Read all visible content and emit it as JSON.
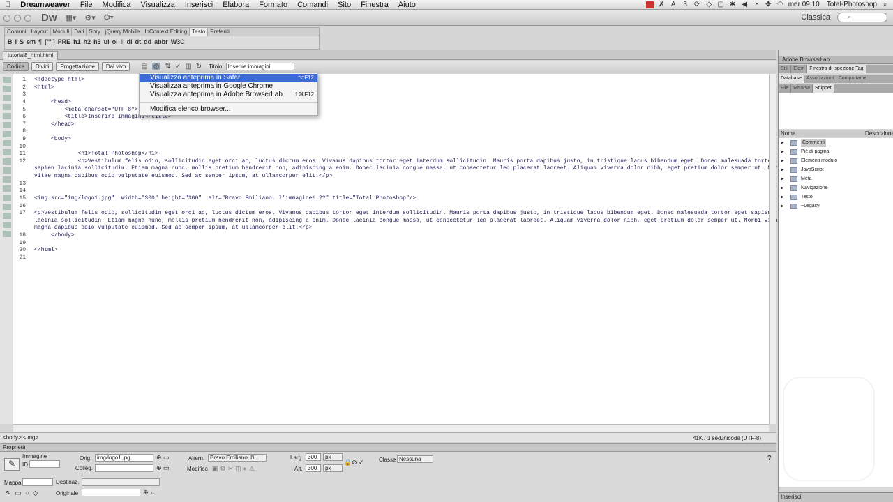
{
  "menubar": {
    "apple": "",
    "app_name": "Dreamweaver",
    "items": [
      "File",
      "Modifica",
      "Visualizza",
      "Inserisci",
      "Elabora",
      "Formato",
      "Comandi",
      "Sito",
      "Finestra",
      "Aiuto"
    ],
    "tray_badge": "3",
    "clock": "mer 09:10",
    "user": "Total-Photoshop"
  },
  "appbar": {
    "logo": "Dw",
    "workspace": "Classica"
  },
  "insert_bar": {
    "tabs": [
      "Comuni",
      "Layout",
      "Moduli",
      "Dati",
      "Spry",
      "jQuery Mobile",
      "InContext Editing",
      "Testo",
      "Preferiti"
    ],
    "active_tab": "Testo",
    "tools": [
      "B",
      "I",
      "S",
      "em",
      "¶",
      "[\"\"]",
      "PRE",
      "h1",
      "h2",
      "h3",
      "ul",
      "ol",
      "li",
      "dl",
      "dt",
      "dd",
      "abbr",
      "W3C"
    ]
  },
  "document": {
    "tab_name": "tutorial8_html.html",
    "views": [
      "Codice",
      "Dividi",
      "Progettazione",
      "Dal vivo"
    ],
    "active_view": "Codice",
    "title_label": "Titolo:",
    "title_value": "Inserire immagini"
  },
  "preview_menu": {
    "items": [
      {
        "label": "Visualizza anteprima in Safari",
        "shortcut": "⌥F12",
        "selected": true
      },
      {
        "label": "Visualizza anteprima in Google Chrome",
        "shortcut": ""
      },
      {
        "label": "Visualizza anteprima in Adobe BrowserLab",
        "shortcut": "⇧⌘F12"
      },
      {
        "label": "Modifica elenco browser...",
        "shortcut": ""
      }
    ]
  },
  "code_lines": [
    {
      "n": "1",
      "text": "<!doctype html>"
    },
    {
      "n": "2",
      "text": "<html>"
    },
    {
      "n": "3",
      "text": ""
    },
    {
      "n": "4",
      "text": "     <head>"
    },
    {
      "n": "5",
      "text": "         <meta charset=\"UTF-8\">"
    },
    {
      "n": "6",
      "text": "         <title>Inserire immagini</title>"
    },
    {
      "n": "7",
      "text": "     </head>"
    },
    {
      "n": "8",
      "text": ""
    },
    {
      "n": "9",
      "text": "     <body>"
    },
    {
      "n": "10",
      "text": ""
    },
    {
      "n": "11",
      "text": "             <h1>Total Photoshop</h1>"
    },
    {
      "n": "12",
      "text": "             <p>Vestibulum felis odio, sollicitudin eget orci ac, luctus dictum eros. Vivamus dapibus tortor eget interdum sollicitudin. Mauris porta dapibus justo, in tristique lacus bibendum eget. Donec malesuada tortor eget"
    },
    {
      "n": "",
      "text": "sapien lacinia sollicitudin. Etiam magna nunc, mollis pretium hendrerit non, adipiscing a enim. Donec lacinia congue massa, ut consectetur leo placerat laoreet. Aliquam viverra dolor nibh, eget pretium dolor semper ut. Morbi"
    },
    {
      "n": "",
      "text": "vitae magna dapibus odio vulputate euismod. Sed ac semper ipsum, at ullamcorper elit.</p>"
    },
    {
      "n": "13",
      "text": ""
    },
    {
      "n": "14",
      "text": ""
    },
    {
      "n": "15",
      "text": "<img src=\"img/logo1.jpg\"  width=\"300\" height=\"300\"  alt=\"Bravo Emiliano, l'immagine!!??\" title=\"Total Photoshop\"/>"
    },
    {
      "n": "16",
      "text": ""
    },
    {
      "n": "17",
      "text": "<p>Vestibulum felis odio, sollicitudin eget orci ac, luctus dictum eros. Vivamus dapibus tortor eget interdum sollicitudin. Mauris porta dapibus justo, in tristique lacus bibendum eget. Donec malesuada tortor eget sapien"
    },
    {
      "n": "",
      "text": "lacinia sollicitudin. Etiam magna nunc, mollis pretium hendrerit non, adipiscing a enim. Donec lacinia congue massa, ut consectetur leo placerat laoreet. Aliquam viverra dolor nibh, eget pretium dolor semper ut. Morbi vitae"
    },
    {
      "n": "",
      "text": "magna dapibus odio vulputate euismod. Sed ac semper ipsum, at ullamcorper elit.</p>"
    },
    {
      "n": "18",
      "text": "     </body>"
    },
    {
      "n": "19",
      "text": ""
    },
    {
      "n": "20",
      "text": "</html>"
    },
    {
      "n": "21",
      "text": ""
    }
  ],
  "status": {
    "tag_selector": "<body> <img>",
    "size": "41K / 1 sec",
    "encoding": "Unicode (UTF-8)"
  },
  "properties": {
    "header": "Proprietà",
    "image_label": "Immagine",
    "id_label": "ID",
    "orig_label": "Orig.",
    "orig_value": "img/logo1.jpg",
    "colleg_label": "Colleg.",
    "altern_label": "Altern.",
    "altern_value": "Bravo Emiliano, l'i...",
    "modifica_label": "Modifica",
    "larg_label": "Larg.",
    "larg_value": "300",
    "alt_label": "Alt.",
    "alt_value": "300",
    "unit": "px",
    "classe_label": "Classe",
    "classe_value": "Nessuna",
    "mappa_label": "Mappa",
    "destinaz_label": "Destinaz.",
    "originale_label": "Originale"
  },
  "right_panel": {
    "browserlab": "Adobe BrowserLab",
    "tabs_row1": [
      "Stili",
      "Elem",
      "Finestra di ispezione Tag"
    ],
    "tabs_row2": [
      "Database",
      "Associazioni",
      "Comportame"
    ],
    "tabs_row3": [
      "File",
      "Risorse",
      "Snippet"
    ],
    "col_name": "Nome",
    "col_desc": "Descrizione",
    "snippets": [
      "Commenti",
      "Piè di pagina",
      "Elementi modulo",
      "JavaScript",
      "Meta",
      "Navigazione",
      "Testo",
      "~Legacy"
    ],
    "bottom": "Inserisci"
  }
}
